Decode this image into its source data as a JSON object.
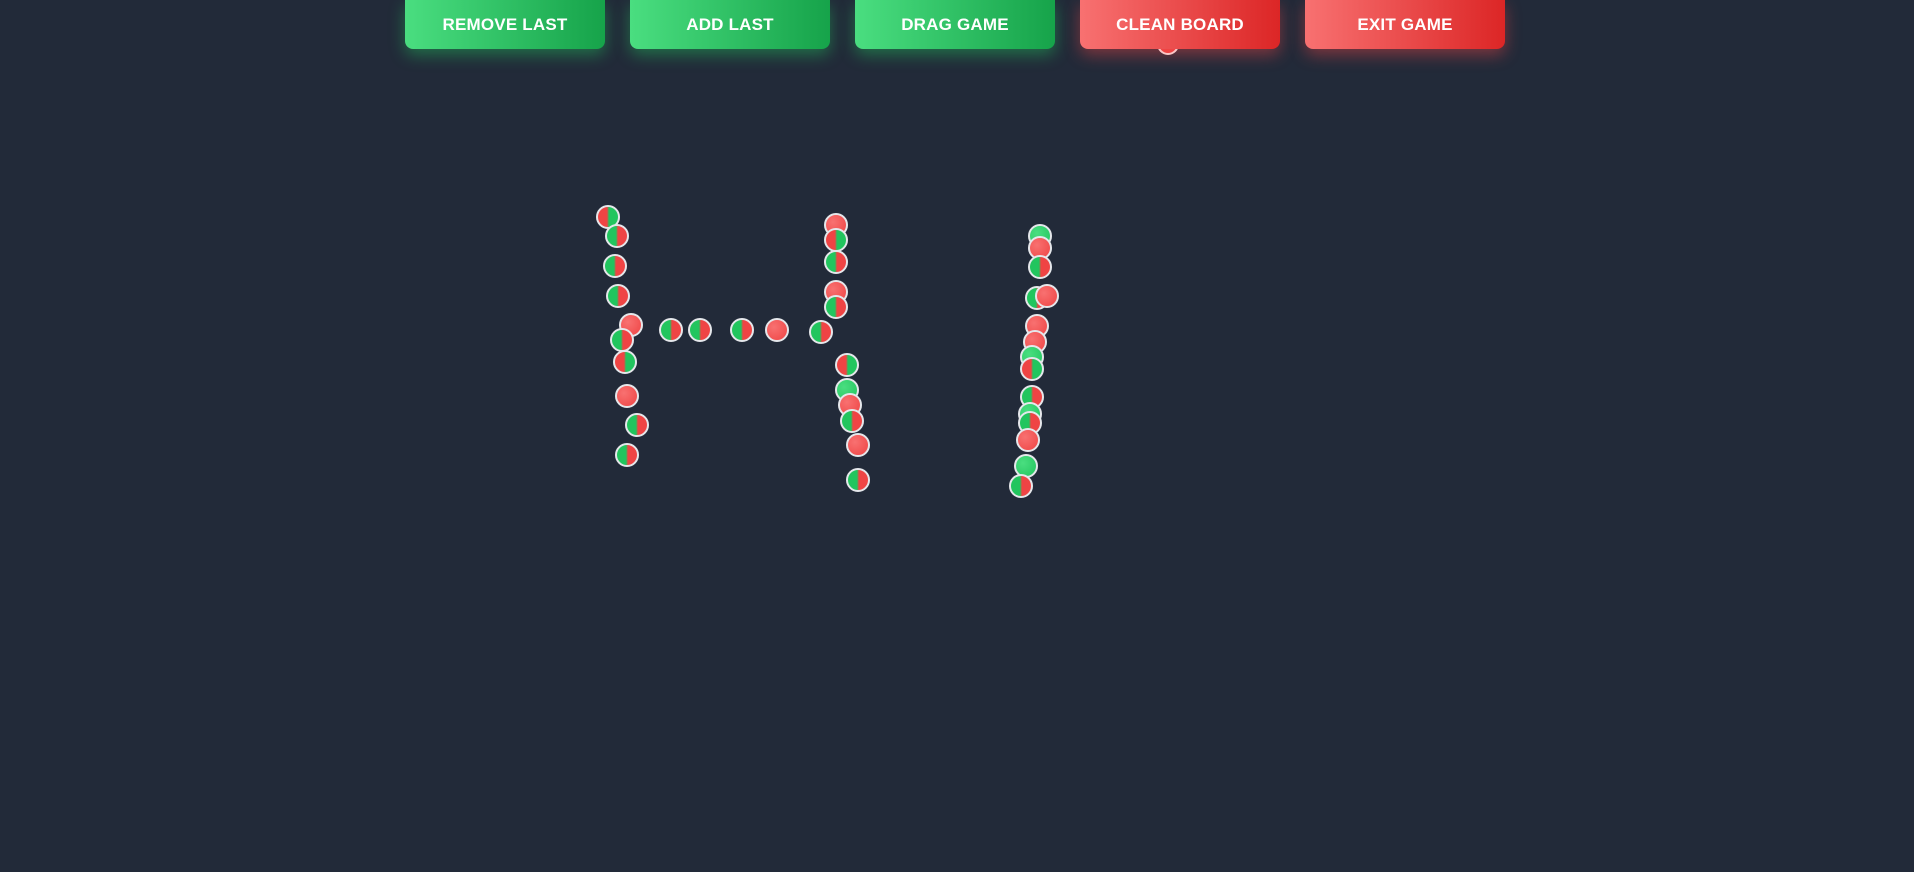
{
  "toolbar": {
    "remove_last_label": "REMOVE LAST",
    "add_last_label": "ADD LAST",
    "drag_game_label": "DRAG GAME",
    "clean_board_label": "CLEAN BOARD",
    "exit_game_label": "EXIT GAME"
  },
  "colors": {
    "background": "#222a39",
    "green_start": "#4ade80",
    "green_end": "#16a34a",
    "red_start": "#f87171",
    "red_end": "#dc2626",
    "ball_green": "#22c55e",
    "ball_red": "#ef4444",
    "ball_border": "#e5e7eb"
  },
  "board": {
    "ball_count": 45
  }
}
